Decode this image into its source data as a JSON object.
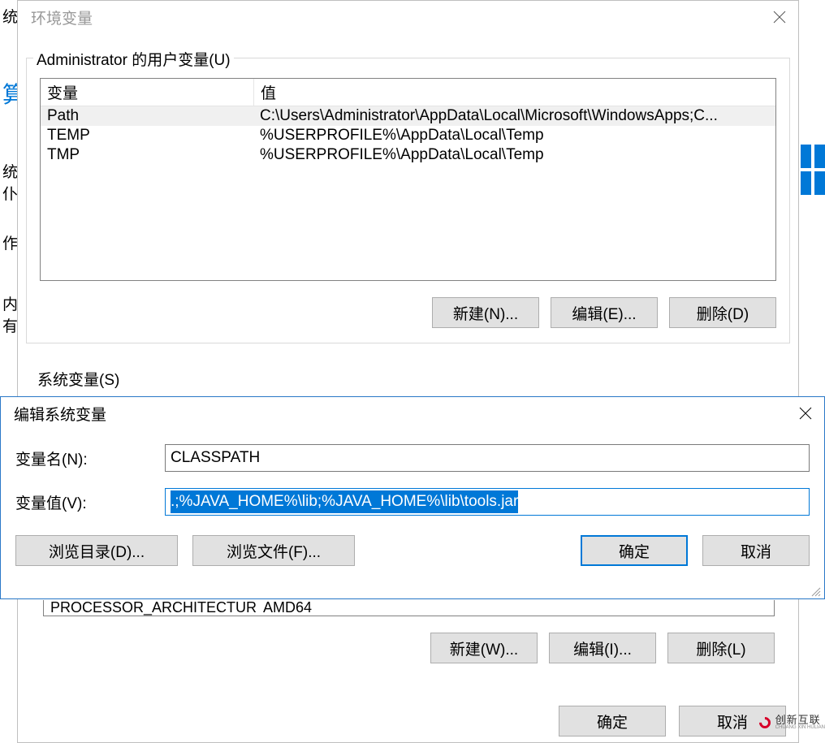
{
  "bgStrip": {
    "item1": "统",
    "item2": "算",
    "item3": "统仆",
    "item4": "作",
    "item5": "内有"
  },
  "envDialog": {
    "title": "环境变量",
    "userGroup": {
      "legend": "Administrator 的用户变量(U)",
      "headers": {
        "var": "变量",
        "val": "值"
      },
      "rows": [
        {
          "var": "Path",
          "val": "C:\\Users\\Administrator\\AppData\\Local\\Microsoft\\WindowsApps;C..."
        },
        {
          "var": "TEMP",
          "val": "%USERPROFILE%\\AppData\\Local\\Temp"
        },
        {
          "var": "TMP",
          "val": "%USERPROFILE%\\AppData\\Local\\Temp"
        }
      ],
      "buttons": {
        "new": "新建(N)...",
        "edit": "编辑(E)...",
        "delete": "删除(D)"
      }
    },
    "systemGroupLabel": "系统变量(S)",
    "systemPeek": {
      "var": "PROCESSOR_ARCHITECTURE",
      "val": "AMD64"
    },
    "systemButtons": {
      "new": "新建(W)...",
      "edit": "编辑(I)...",
      "delete": "删除(L)"
    },
    "okCancel": {
      "ok": "确定",
      "cancel": "取消"
    }
  },
  "editDialog": {
    "title": "编辑系统变量",
    "nameLabel": "变量名(N):",
    "nameValue": "CLASSPATH",
    "valueLabel": "变量值(V):",
    "valueValue": ".;%JAVA_HOME%\\lib;%JAVA_HOME%\\lib\\tools.jar",
    "buttons": {
      "browseDir": "浏览目录(D)...",
      "browseFile": "浏览文件(F)...",
      "ok": "确定",
      "cancel": "取消"
    }
  },
  "watermark": {
    "main": "创新互联",
    "sub": "CHUANG XIN HULIAN"
  }
}
